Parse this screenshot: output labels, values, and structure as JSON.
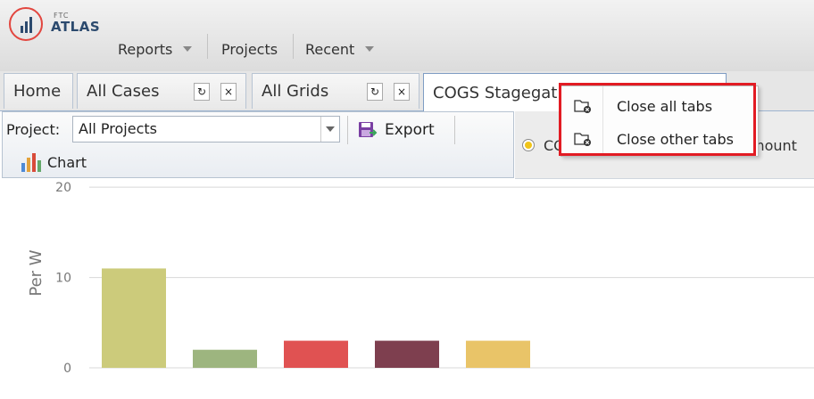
{
  "logo": {
    "small_text": "FTC",
    "name": "ATLAS",
    "ring_color": "#e2463f",
    "brand_color": "#2c4a6e"
  },
  "menu": [
    {
      "label": "Reports",
      "has_caret": true
    },
    {
      "label": "Projects",
      "has_caret": false
    },
    {
      "label": "Recent",
      "has_caret": true
    }
  ],
  "tabs": [
    {
      "label": "Home"
    },
    {
      "label": "All Cases",
      "refresh": "↻",
      "close": "×"
    },
    {
      "label": "All Grids",
      "refresh": "↻",
      "close": "×"
    },
    {
      "label": "COGS Stagegat",
      "active": true
    }
  ],
  "toolbar": {
    "project_label": "Project:",
    "project_value": "All Projects",
    "export_label": "Export",
    "chart_label": "Chart"
  },
  "right_pane": {
    "option1_partial": "CO",
    "option2_partial": "mount"
  },
  "context_menu": [
    {
      "label": "Close all tabs",
      "icon": "close-folder-icon"
    },
    {
      "label": "Close other tabs",
      "icon": "close-folder-icon"
    }
  ],
  "highlight_color": "#e21b23",
  "chart_data": {
    "type": "bar",
    "ylabel": "Per W",
    "yticks": [
      0,
      10,
      20
    ],
    "ylim": [
      0,
      21
    ],
    "series": [
      {
        "value": 11,
        "color": "#cccb7b"
      },
      {
        "value": 2,
        "color": "#9db57f"
      },
      {
        "value": 3,
        "color": "#e05252"
      },
      {
        "value": 3,
        "color": "#7e3f4f"
      },
      {
        "value": 3,
        "color": "#e9c468"
      }
    ]
  }
}
